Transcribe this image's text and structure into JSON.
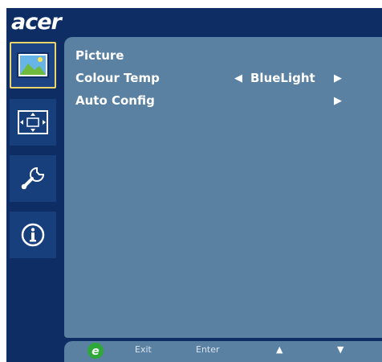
{
  "brand": {
    "logo_text": "acer"
  },
  "menu_icons": [
    {
      "name": "picture-icon",
      "selected": true
    },
    {
      "name": "image-position-icon",
      "selected": false
    },
    {
      "name": "setup-wrench-icon",
      "selected": false
    },
    {
      "name": "information-icon",
      "selected": false
    }
  ],
  "panel": {
    "title": "Picture",
    "rows": [
      {
        "label": "Colour Temp",
        "value": "BlueLight",
        "has_left_arrow": true,
        "has_right_arrow": true
      },
      {
        "label": "Auto Config",
        "value": "",
        "has_left_arrow": false,
        "has_right_arrow": true
      }
    ],
    "arrow_left_glyph": "◀",
    "arrow_right_glyph": "▶"
  },
  "bottom_bar": {
    "exit_label": "Exit",
    "enter_label": "Enter",
    "up_glyph": "▲",
    "down_glyph": "▼"
  },
  "colors": {
    "frame": "#0e2d64",
    "panel": "#5a80a2",
    "selected_border": "#e7d56a",
    "e_key_green": "#2fa83a"
  }
}
